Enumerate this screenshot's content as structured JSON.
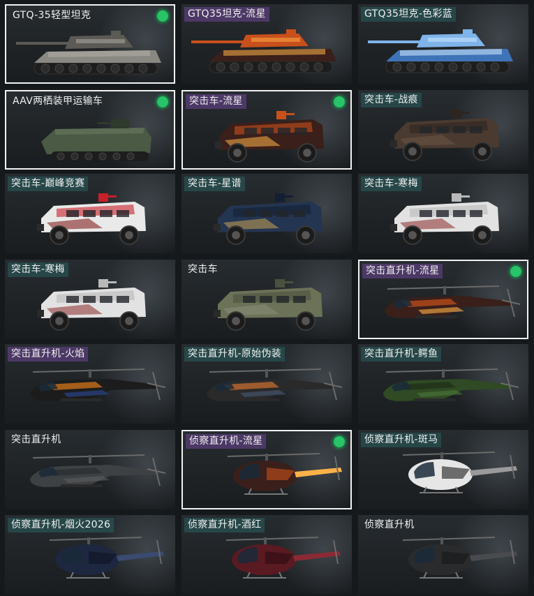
{
  "cards": [
    {
      "name": "GTQ-35轻型坦克",
      "kind": "tank",
      "skin": "stone",
      "tag": "none",
      "equipped": true,
      "selected": true
    },
    {
      "name": "GTQ35坦克-流星",
      "kind": "tank",
      "skin": "meteor",
      "tag": "purple",
      "equipped": false,
      "selected": false
    },
    {
      "name": "GTQ35坦克-色彩蓝",
      "kind": "tank",
      "skin": "blue",
      "tag": "teal",
      "equipped": false,
      "selected": false
    },
    {
      "name": "AAV两栖装甲运输车",
      "kind": "amphib",
      "skin": "olive",
      "tag": "none",
      "equipped": true,
      "selected": true
    },
    {
      "name": "突击车-流星",
      "kind": "truck",
      "skin": "meteor",
      "tag": "purple",
      "equipped": true,
      "selected": true
    },
    {
      "name": "突击车-战痕",
      "kind": "truck",
      "skin": "rust",
      "tag": "teal",
      "equipped": false,
      "selected": false
    },
    {
      "name": "突击车-巅峰竞赛",
      "kind": "truck",
      "skin": "race",
      "tag": "teal",
      "equipped": false,
      "selected": false
    },
    {
      "name": "突击车-星谱",
      "kind": "truck",
      "skin": "star",
      "tag": "teal",
      "equipped": false,
      "selected": false
    },
    {
      "name": "突击车-寒梅",
      "kind": "truck",
      "skin": "white",
      "tag": "teal",
      "equipped": false,
      "selected": false
    },
    {
      "name": "突击车-寒梅",
      "kind": "truck",
      "skin": "white",
      "tag": "teal",
      "equipped": false,
      "selected": false
    },
    {
      "name": "突击车",
      "kind": "truck",
      "skin": "green",
      "tag": "none",
      "equipped": false,
      "selected": false
    },
    {
      "name": "突击直升机-流星",
      "kind": "heli",
      "skin": "meteor",
      "tag": "purple",
      "equipped": true,
      "selected": true
    },
    {
      "name": "突击直升机-火焰",
      "kind": "heli",
      "skin": "flame",
      "tag": "purple",
      "equipped": false,
      "selected": false
    },
    {
      "name": "突击直升机-原始伪装",
      "kind": "heli",
      "skin": "camo",
      "tag": "teal",
      "equipped": false,
      "selected": false
    },
    {
      "name": "突击直升机-鳄鱼",
      "kind": "heli",
      "skin": "croc",
      "tag": "teal",
      "equipped": false,
      "selected": false
    },
    {
      "name": "突击直升机",
      "kind": "heli",
      "skin": "grey",
      "tag": "none",
      "equipped": false,
      "selected": false
    },
    {
      "name": "侦察直升机-流星",
      "kind": "scout",
      "skin": "meteor",
      "tag": "purple",
      "equipped": true,
      "selected": true
    },
    {
      "name": "侦察直升机-斑马",
      "kind": "scout",
      "skin": "zebra",
      "tag": "teal",
      "equipped": false,
      "selected": false
    },
    {
      "name": "侦察直升机-烟火2026",
      "kind": "scout",
      "skin": "navy",
      "tag": "teal",
      "equipped": false,
      "selected": false
    },
    {
      "name": "侦察直升机-酒红",
      "kind": "scout",
      "skin": "wine",
      "tag": "teal",
      "equipped": false,
      "selected": false
    },
    {
      "name": "侦察直升机",
      "kind": "scout",
      "skin": "black",
      "tag": "none",
      "equipped": false,
      "selected": false
    }
  ],
  "colors": {
    "equipped_dot": "#29c36a",
    "selected_border": "#f2f2f2",
    "tag_purple": "#6e4696",
    "tag_teal": "#285f5f"
  }
}
